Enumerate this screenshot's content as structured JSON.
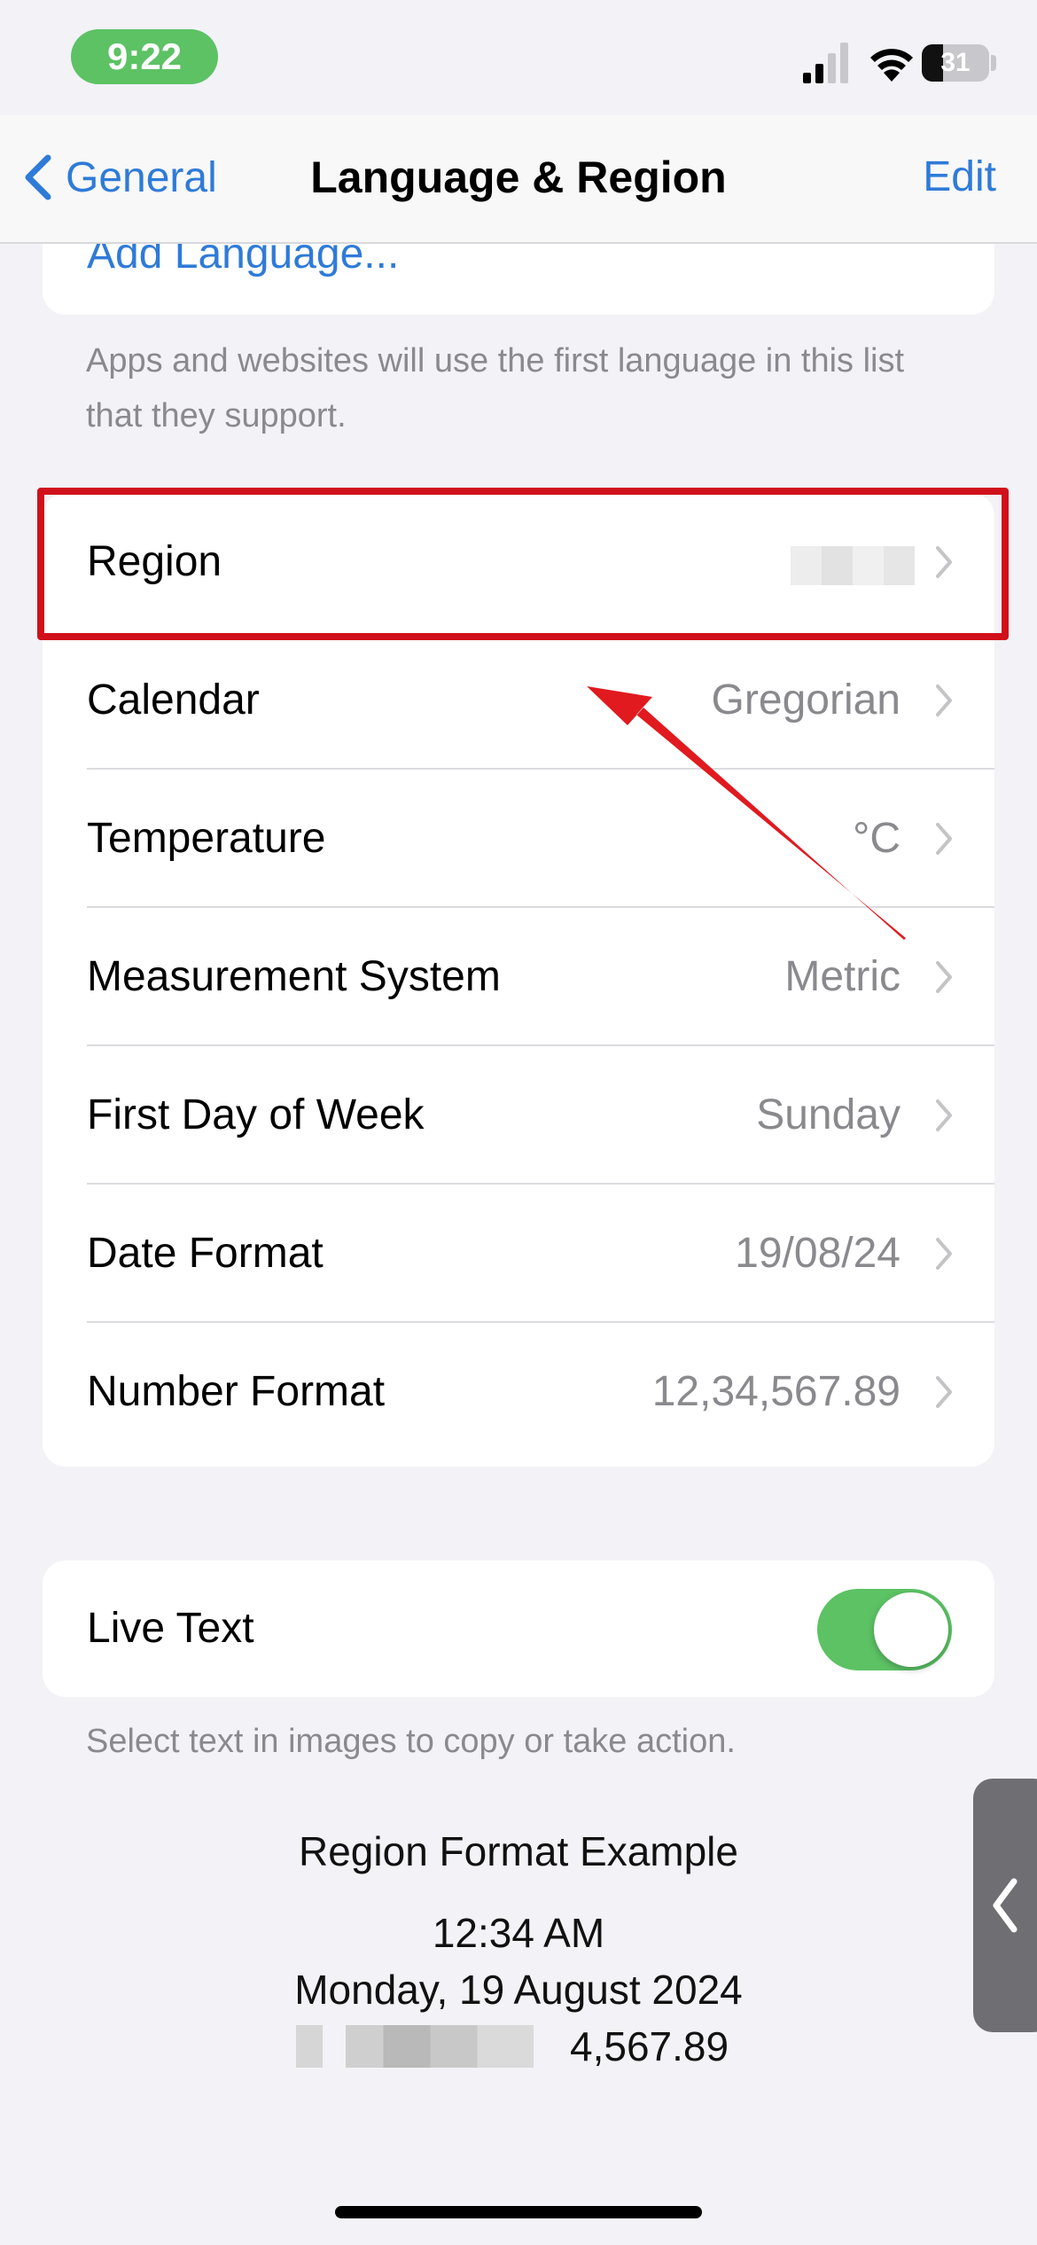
{
  "status_bar": {
    "time": "9:22",
    "battery": "31",
    "battery_level": 0.31,
    "cellular_bars": 2
  },
  "nav": {
    "back_label": "General",
    "title": "Language & Region",
    "edit_label": "Edit"
  },
  "languages": {
    "add_language_label": "Add Language...",
    "footer": "Apps and websites will use the first language in this list that they support."
  },
  "region_settings": {
    "rows": [
      {
        "label": "Region",
        "value": ""
      },
      {
        "label": "Calendar",
        "value": "Gregorian"
      },
      {
        "label": "Temperature",
        "value": "°C"
      },
      {
        "label": "Measurement System",
        "value": "Metric"
      },
      {
        "label": "First Day of Week",
        "value": "Sunday"
      },
      {
        "label": "Date Format",
        "value": "19/08/24"
      },
      {
        "label": "Number Format",
        "value": "12,34,567.89"
      }
    ]
  },
  "live_text": {
    "label": "Live Text",
    "enabled": true,
    "footer": "Select text in images to copy or take action."
  },
  "region_example": {
    "title": "Region Format Example",
    "time": "12:34 AM",
    "date": "Monday, 19 August 2024",
    "number": "4,567.89"
  },
  "colors": {
    "accent": "#2f7bd8",
    "toggle_on": "#5cc264",
    "highlight": "#d0111b",
    "background": "#f2f2f7"
  }
}
